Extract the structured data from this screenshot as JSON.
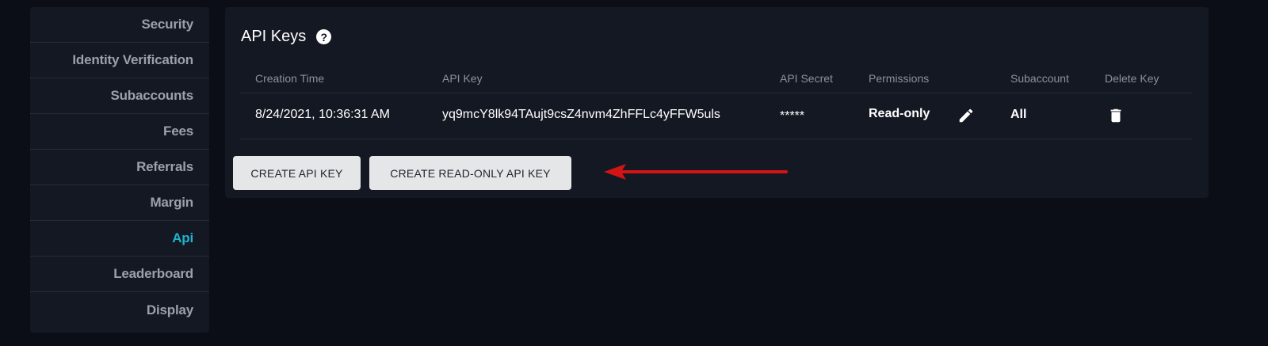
{
  "sidebar": {
    "items": [
      {
        "label": "Security"
      },
      {
        "label": "Identity Verification"
      },
      {
        "label": "Subaccounts"
      },
      {
        "label": "Fees"
      },
      {
        "label": "Referrals"
      },
      {
        "label": "Margin"
      },
      {
        "label": "Api",
        "active": true
      },
      {
        "label": "Leaderboard"
      },
      {
        "label": "Display"
      }
    ]
  },
  "panel": {
    "title": "API Keys",
    "help_icon": "?",
    "columns": {
      "creation_time": "Creation Time",
      "api_key": "API Key",
      "api_secret": "API Secret",
      "permissions": "Permissions",
      "subaccount": "Subaccount",
      "delete_key": "Delete Key"
    },
    "rows": [
      {
        "creation_time": "8/24/2021, 10:36:31 AM",
        "api_key": "yq9mcY8lk94TAujt9csZ4nvm4ZhFFLc4yFFW5uls",
        "api_secret": "*****",
        "permissions": "Read-only",
        "subaccount": "All"
      }
    ],
    "buttons": {
      "create": "CREATE API KEY",
      "create_readonly": "CREATE READ-ONLY API KEY"
    }
  },
  "colors": {
    "background": "#0b0e16",
    "panel": "#141822",
    "active": "#1fb3cc",
    "annotation_arrow": "#d41414"
  },
  "icons": [
    "help-icon",
    "pencil-icon",
    "trash-icon",
    "arrow-annotation"
  ]
}
